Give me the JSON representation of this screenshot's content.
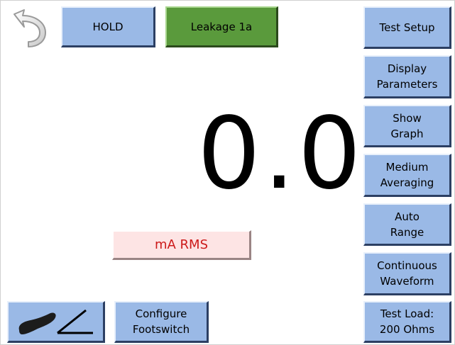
{
  "header": {
    "hold_label": "HOLD",
    "mode_label": "Leakage 1a"
  },
  "reading": {
    "value": "0.0",
    "unit": "mA RMS"
  },
  "sidebar": {
    "items": [
      {
        "label": "Test Setup"
      },
      {
        "label": "Display\nParameters"
      },
      {
        "label": "Show\nGraph"
      },
      {
        "label": "Medium\nAveraging"
      },
      {
        "label": "Auto\nRange"
      },
      {
        "label": "Continuous\nWaveform"
      },
      {
        "label": "Test Load:\n200 Ohms"
      }
    ]
  },
  "footer": {
    "footswitch_label": "Configure\nFootswitch",
    "footswitch_icon": "footswitch-pedal-icon"
  },
  "colors": {
    "button_blue": "#9ab9e6",
    "mode_green": "#5a9a3c",
    "unit_bg": "#fde4e4",
    "unit_text": "#cc1a1a"
  }
}
